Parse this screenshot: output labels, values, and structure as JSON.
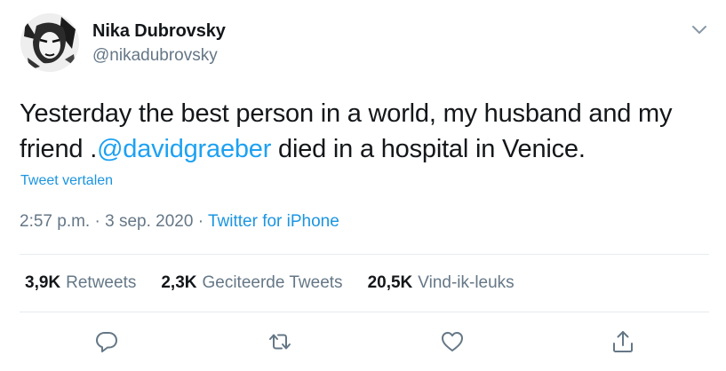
{
  "author": {
    "name": "Nika Dubrovsky",
    "handle": "@nikadubrovsky"
  },
  "tweet": {
    "text_before": "Yesterday the best person in a world, my husband and my friend .",
    "mention": "@davidgraeber",
    "text_after": " died in a hospital in Venice.",
    "translate_label": "Tweet vertalen",
    "time": "2:57 p.m.",
    "separator1": " · ",
    "date": "3 sep. 2020",
    "separator2": " · ",
    "source": "Twitter for iPhone"
  },
  "stats": {
    "retweets_count": "3,9K",
    "retweets_label": "Retweets",
    "quotes_count": "2,3K",
    "quotes_label": "Geciteerde Tweets",
    "likes_count": "20,5K",
    "likes_label": "Vind-ik-leuks"
  },
  "icons": {
    "more": "chevron-down-icon",
    "reply": "reply-icon",
    "retweet": "retweet-icon",
    "like": "heart-icon",
    "share": "share-icon"
  },
  "colors": {
    "link": "#1da1f2",
    "secondary_text": "#657786",
    "icon": "#657786",
    "divider": "#e6ecf0"
  }
}
